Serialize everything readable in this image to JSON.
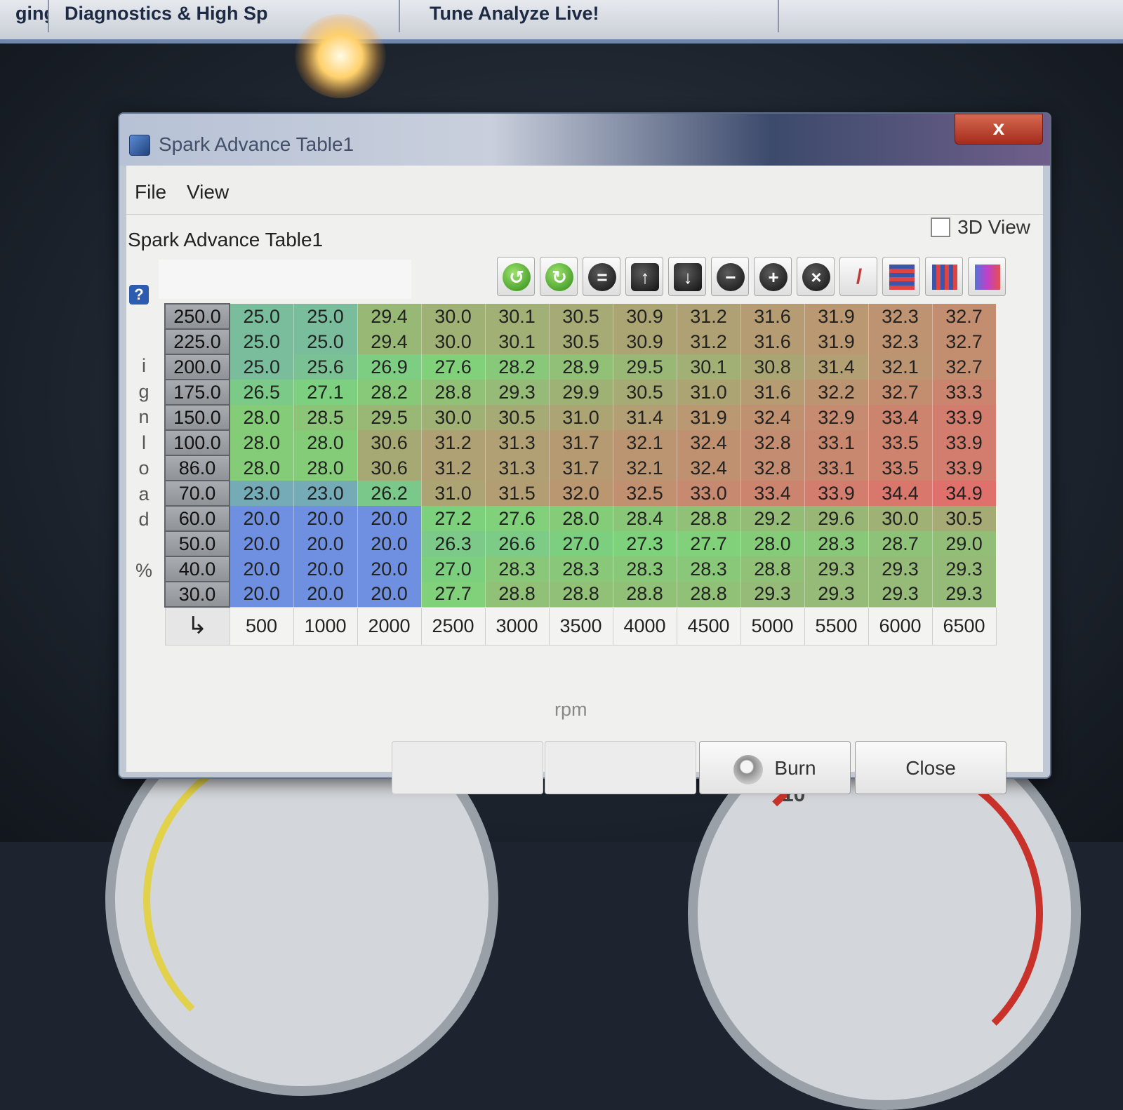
{
  "background": {
    "tabs": [
      "ging",
      "Diagnostics & High Sp",
      "Tune Analyze Live!"
    ],
    "gauge_numbers": [
      "10"
    ]
  },
  "window": {
    "title": "Spark Advance Table1",
    "close_label": "x",
    "menu": [
      "File",
      "View"
    ],
    "panel_title": "Spark Advance Table1",
    "view3d_label": "3D View",
    "help_label": "?"
  },
  "toolbar": {
    "icons": [
      "rotate-left-icon",
      "rotate-right-icon",
      "equals-icon",
      "arrow-up-icon",
      "arrow-down-icon",
      "minus-icon",
      "plus-icon",
      "multiply-icon",
      "pencil-icon",
      "rows-icon",
      "columns-icon",
      "color-bars-icon"
    ]
  },
  "table": {
    "y_axis_label": [
      "i",
      "g",
      "n",
      "l",
      "o",
      "a",
      "d",
      "",
      "%"
    ],
    "x_axis_label": "rpm",
    "corner_icon": "↳",
    "x_headers": [
      "500",
      "1000",
      "2000",
      "2500",
      "3000",
      "3500",
      "4000",
      "4500",
      "5000",
      "5500",
      "6000",
      "6500"
    ],
    "rows": [
      {
        "load": "250.0",
        "cells": [
          "25.0",
          "25.0",
          "29.4",
          "30.0",
          "30.1",
          "30.5",
          "30.9",
          "31.2",
          "31.6",
          "31.9",
          "32.3",
          "32.7"
        ]
      },
      {
        "load": "225.0",
        "cells": [
          "25.0",
          "25.0",
          "29.4",
          "30.0",
          "30.1",
          "30.5",
          "30.9",
          "31.2",
          "31.6",
          "31.9",
          "32.3",
          "32.7"
        ]
      },
      {
        "load": "200.0",
        "cells": [
          "25.0",
          "25.6",
          "26.9",
          "27.6",
          "28.2",
          "28.9",
          "29.5",
          "30.1",
          "30.8",
          "31.4",
          "32.1",
          "32.7"
        ]
      },
      {
        "load": "175.0",
        "cells": [
          "26.5",
          "27.1",
          "28.2",
          "28.8",
          "29.3",
          "29.9",
          "30.5",
          "31.0",
          "31.6",
          "32.2",
          "32.7",
          "33.3"
        ]
      },
      {
        "load": "150.0",
        "cells": [
          "28.0",
          "28.5",
          "29.5",
          "30.0",
          "30.5",
          "31.0",
          "31.4",
          "31.9",
          "32.4",
          "32.9",
          "33.4",
          "33.9"
        ]
      },
      {
        "load": "100.0",
        "cells": [
          "28.0",
          "28.0",
          "30.6",
          "31.2",
          "31.3",
          "31.7",
          "32.1",
          "32.4",
          "32.8",
          "33.1",
          "33.5",
          "33.9"
        ]
      },
      {
        "load": "86.0",
        "cells": [
          "28.0",
          "28.0",
          "30.6",
          "31.2",
          "31.3",
          "31.7",
          "32.1",
          "32.4",
          "32.8",
          "33.1",
          "33.5",
          "33.9"
        ]
      },
      {
        "load": "70.0",
        "cells": [
          "23.0",
          "23.0",
          "26.2",
          "31.0",
          "31.5",
          "32.0",
          "32.5",
          "33.0",
          "33.4",
          "33.9",
          "34.4",
          "34.9"
        ]
      },
      {
        "load": "60.0",
        "cells": [
          "20.0",
          "20.0",
          "20.0",
          "27.2",
          "27.6",
          "28.0",
          "28.4",
          "28.8",
          "29.2",
          "29.6",
          "30.0",
          "30.5"
        ]
      },
      {
        "load": "50.0",
        "cells": [
          "20.0",
          "20.0",
          "20.0",
          "26.3",
          "26.6",
          "27.0",
          "27.3",
          "27.7",
          "28.0",
          "28.3",
          "28.7",
          "29.0"
        ]
      },
      {
        "load": "40.0",
        "cells": [
          "20.0",
          "20.0",
          "20.0",
          "27.0",
          "28.3",
          "28.3",
          "28.3",
          "28.3",
          "28.8",
          "29.3",
          "29.3",
          "29.3"
        ]
      },
      {
        "load": "30.0",
        "cells": [
          "20.0",
          "20.0",
          "20.0",
          "27.7",
          "28.8",
          "28.8",
          "28.8",
          "28.8",
          "29.3",
          "29.3",
          "29.3",
          "29.3"
        ]
      }
    ],
    "colors": {
      "low": "#6f8fe0",
      "mid": "#7ed37a",
      "high": "#e0706c"
    }
  },
  "buttons": {
    "burn_label": "Burn",
    "close_label": "Close"
  }
}
